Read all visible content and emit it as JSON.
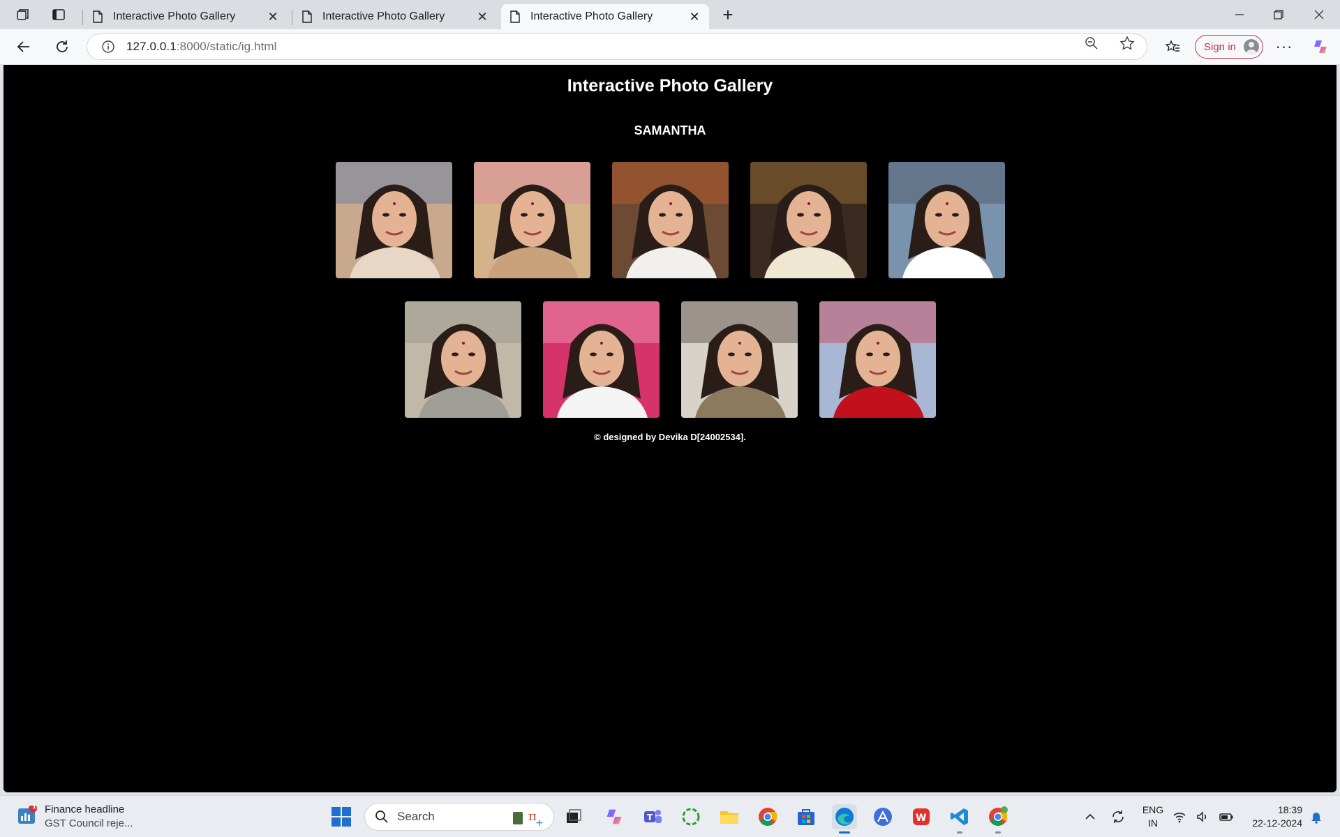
{
  "browser": {
    "tabs": [
      {
        "title": "Interactive Photo Gallery"
      },
      {
        "title": "Interactive Photo Gallery"
      },
      {
        "title": "Interactive Photo Gallery"
      }
    ],
    "address": {
      "host": "127.0.0.1",
      "path": ":8000/static/ig.html"
    },
    "signin_label": "Sign in"
  },
  "page": {
    "title": "Interactive Photo Gallery",
    "subtitle": "SAMANTHA",
    "gallery_rows": [
      [
        {
          "bg": "#c9a98e",
          "accent": "#3a6fb0",
          "cloth": "#e8d7c7"
        },
        {
          "bg": "#d4b38a",
          "accent": "#e07aa8",
          "cloth": "#c9a27c"
        },
        {
          "bg": "#6d4a33",
          "accent": "#d9622b",
          "cloth": "#f2f0ec"
        },
        {
          "bg": "#3a2a20",
          "accent": "#c08a3a",
          "cloth": "#efe7d2"
        },
        {
          "bg": "#7a93ad",
          "accent": "#38414c",
          "cloth": "#ffffff"
        }
      ],
      [
        {
          "bg": "#c2b8a8",
          "accent": "#8a8a82",
          "cloth": "#9e9e96"
        },
        {
          "bg": "#d6336a",
          "accent": "#f6c0d2",
          "cloth": "#f4f4f4"
        },
        {
          "bg": "#d9d2c8",
          "accent": "#2a211c",
          "cloth": "#8c7a5e"
        },
        {
          "bg": "#a8b7d4",
          "accent": "#d01e2a",
          "cloth": "#c2101c"
        }
      ]
    ],
    "footer": "© designed by Devika D[24002534]."
  },
  "taskbar": {
    "news_title": "Finance headline",
    "news_text": "GST Council reje...",
    "news_badge": "1",
    "search_placeholder": "Search",
    "lang_1": "ENG",
    "lang_2": "IN",
    "time": "18:39",
    "date": "22-12-2024"
  }
}
